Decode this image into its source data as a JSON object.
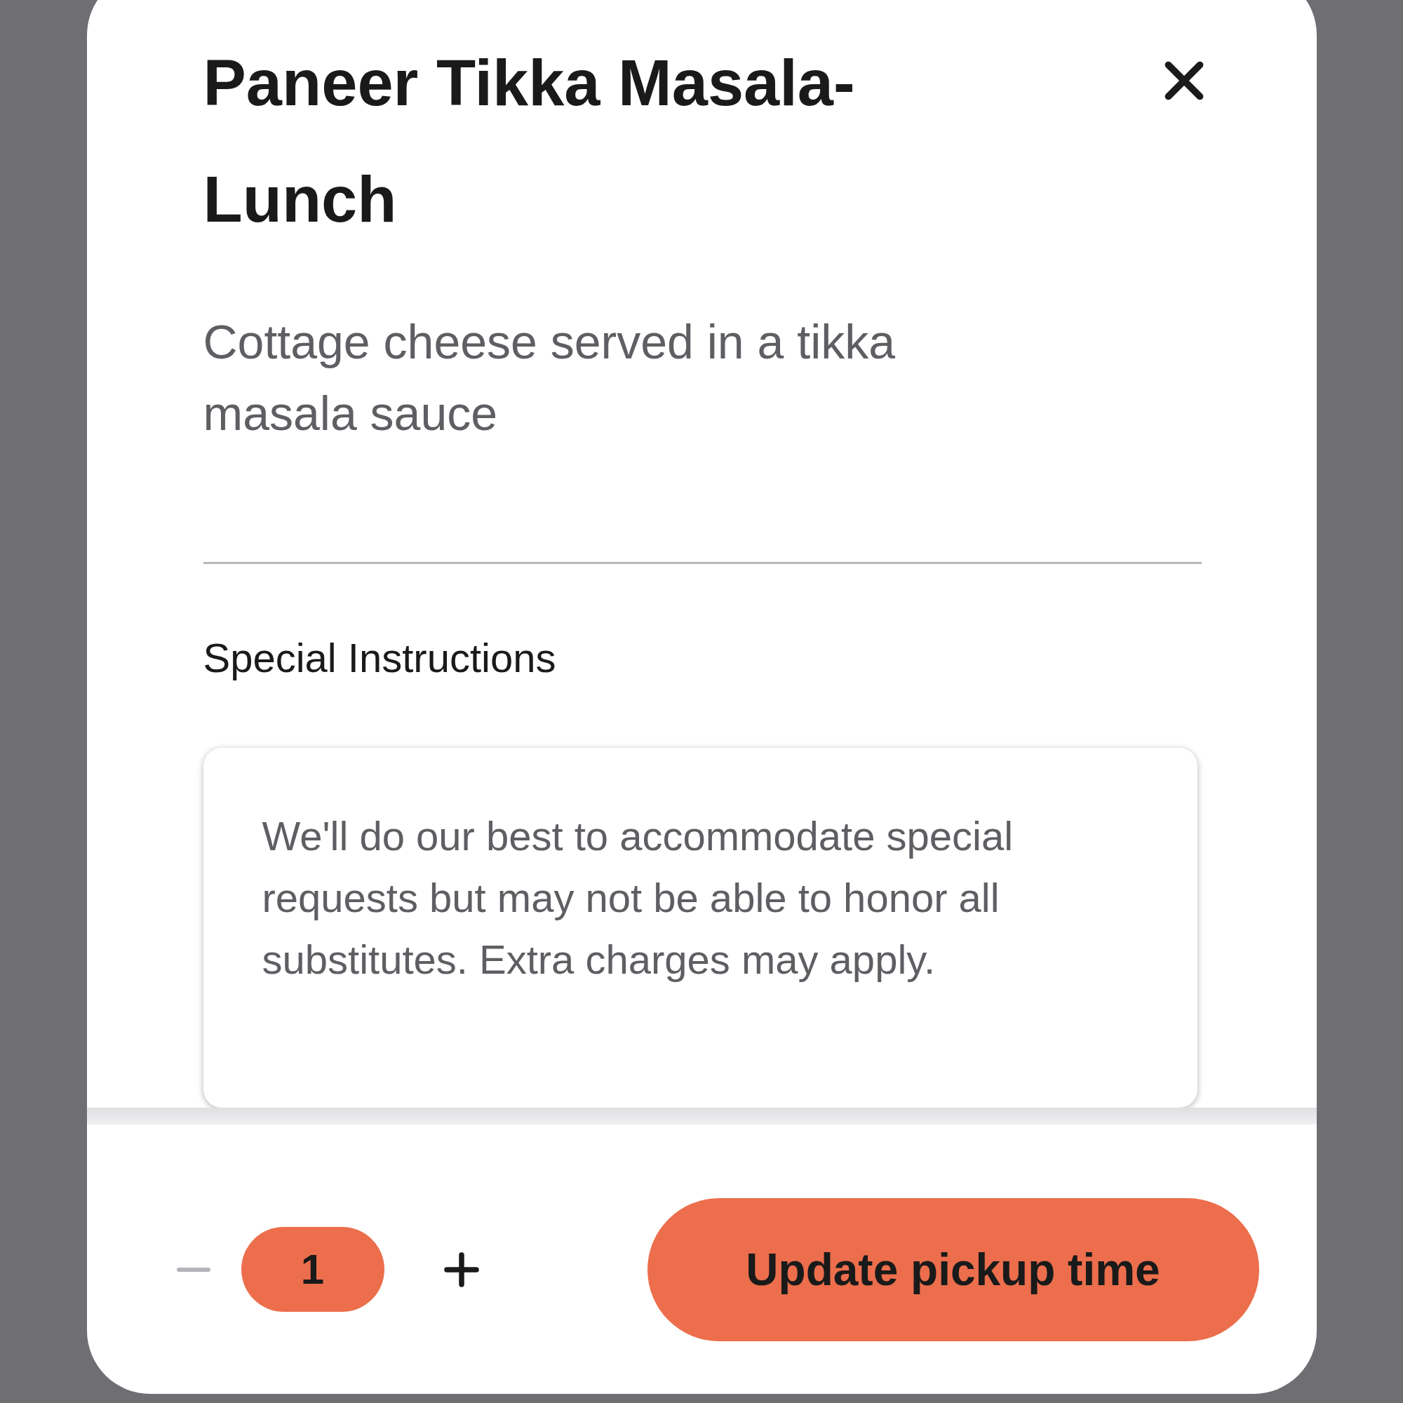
{
  "item": {
    "title": "Paneer Tikka Masala-Lunch",
    "description": "Cottage cheese served in a tikka masala sauce"
  },
  "special_instructions": {
    "label": "Special Instructions",
    "placeholder": "We'll do our best to accommodate special requests but may not be able to honor all substitutes. Extra charges may apply."
  },
  "quantity": {
    "value": "1",
    "decrease_disabled": true
  },
  "action_button": {
    "label": "Update pickup time"
  }
}
